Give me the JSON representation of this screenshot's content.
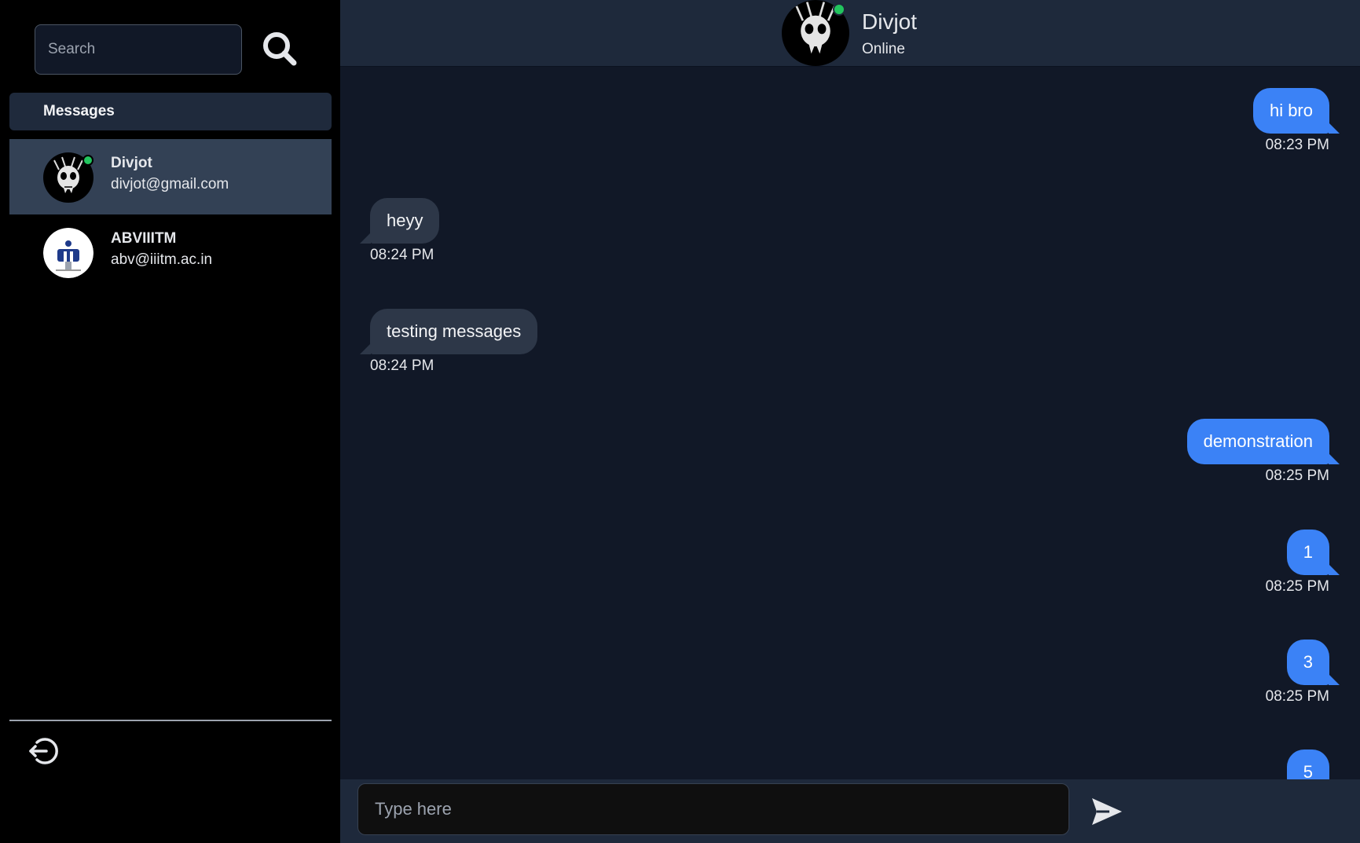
{
  "sidebar": {
    "search_placeholder": "Search",
    "messages_header": "Messages",
    "contacts": [
      {
        "name": "Divjot",
        "email": "divjot@gmail.com",
        "online": true,
        "active": true
      },
      {
        "name": "ABVIIITM",
        "email": "abv@iiitm.ac.in",
        "online": false,
        "active": false
      }
    ]
  },
  "chat": {
    "header": {
      "name": "Divjot",
      "status": "Online"
    },
    "messages": [
      {
        "text": "hi bro",
        "time": "08:23 PM",
        "direction": "sent"
      },
      {
        "text": "heyy",
        "time": "08:24 PM",
        "direction": "received"
      },
      {
        "text": "testing messages",
        "time": "08:24 PM",
        "direction": "received"
      },
      {
        "text": "demonstration",
        "time": "08:25 PM",
        "direction": "sent"
      },
      {
        "text": "1",
        "time": "08:25 PM",
        "direction": "sent"
      },
      {
        "text": "3",
        "time": "08:25 PM",
        "direction": "sent"
      },
      {
        "text": "5",
        "time": "",
        "direction": "sent"
      }
    ],
    "composer_placeholder": "Type here"
  },
  "colors": {
    "sent_bubble": "#3b82f6",
    "received_bubble": "#2d3748",
    "online": "#22c55e",
    "chat_bg": "#111827",
    "active_contact": "#334155"
  },
  "icons": {
    "search": "search-icon",
    "logout": "logout-icon",
    "send": "send-icon"
  }
}
